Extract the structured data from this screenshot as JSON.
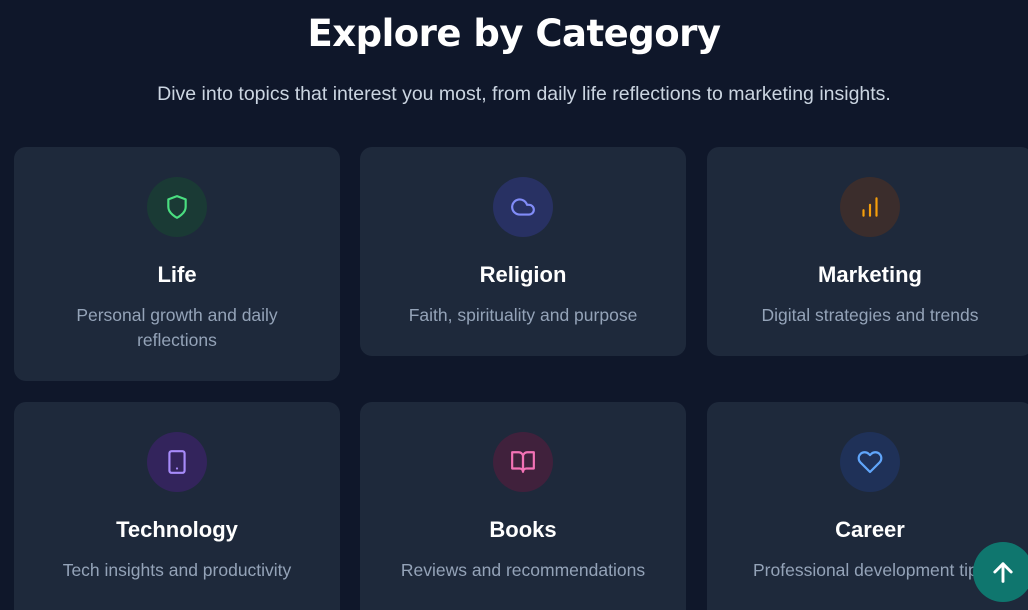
{
  "header": {
    "title": "Explore by Category",
    "subtitle": "Dive into topics that interest you most, from daily life reflections to marketing insights."
  },
  "categories": [
    {
      "title": "Life",
      "description": "Personal growth and daily reflections",
      "icon": "shield-icon",
      "icon_color": "#4ade80",
      "icon_bg": "#1a3a35"
    },
    {
      "title": "Religion",
      "description": "Faith, spirituality and purpose",
      "icon": "cloud-icon",
      "icon_color": "#818cf8",
      "icon_bg": "#283163"
    },
    {
      "title": "Marketing",
      "description": "Digital strategies and trends",
      "icon": "bar-chart-icon",
      "icon_color": "#f59e0b",
      "icon_bg": "#3b2d2c"
    },
    {
      "title": "Technology",
      "description": "Tech insights and productivity",
      "icon": "tablet-icon",
      "icon_color": "#a78bfa",
      "icon_bg": "#33245c"
    },
    {
      "title": "Books",
      "description": "Reviews and recommendations",
      "icon": "book-open-icon",
      "icon_color": "#f472b6",
      "icon_bg": "#40213c"
    },
    {
      "title": "Career",
      "description": "Professional development tips",
      "icon": "heart-icon",
      "icon_color": "#60a5fa",
      "icon_bg": "#1f3158"
    }
  ],
  "colors": {
    "background": "#0f172a",
    "card": "#1e293b",
    "scroll_top_button": "#0f766e"
  }
}
